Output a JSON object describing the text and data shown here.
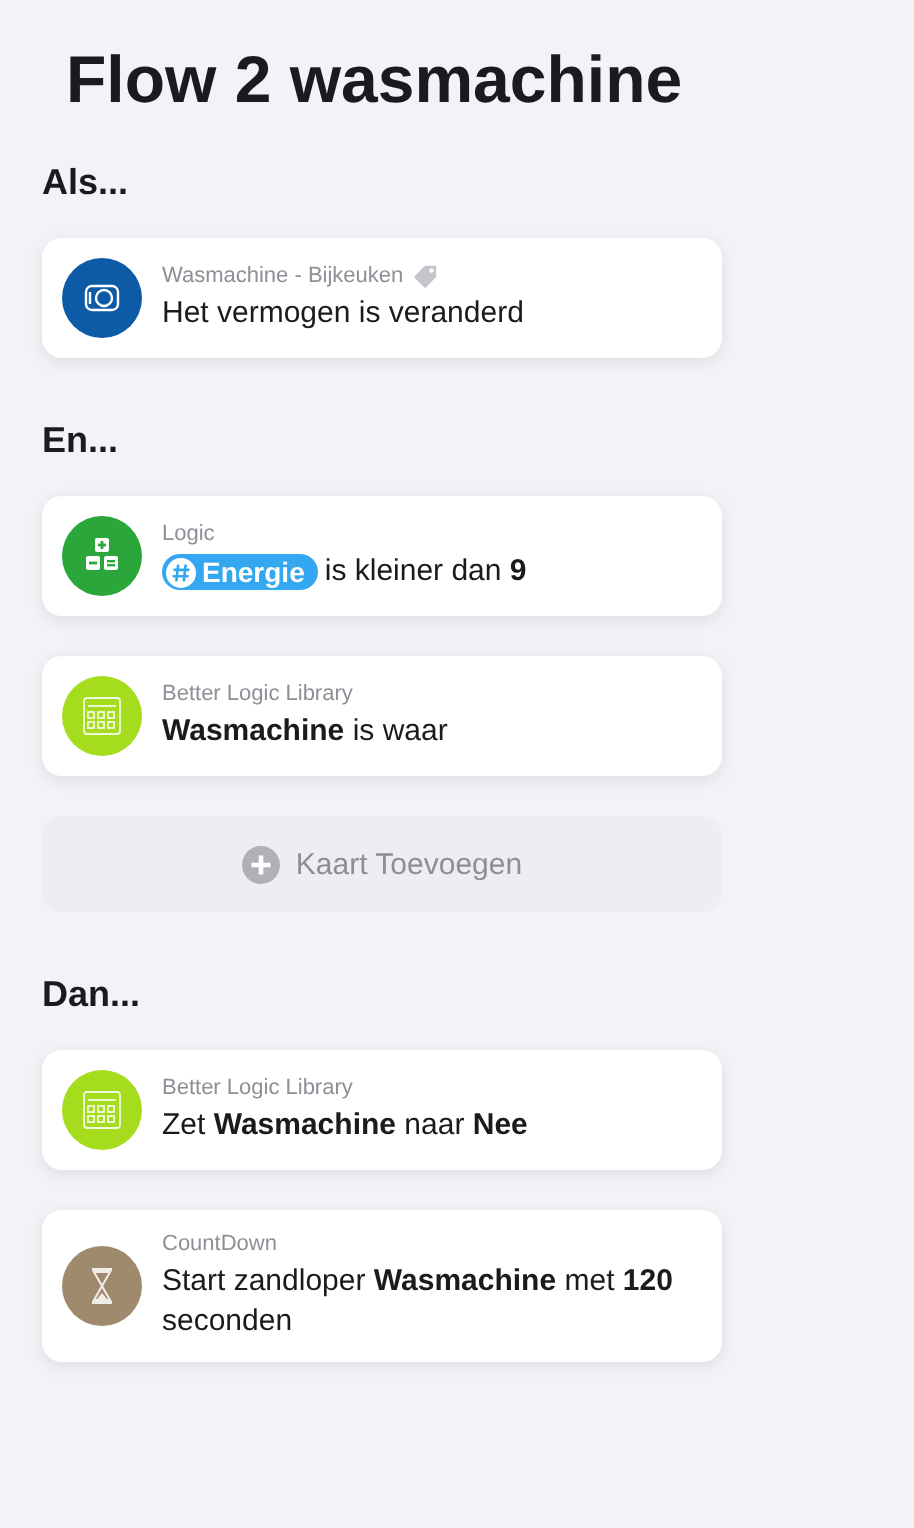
{
  "title": "Flow 2 wasmachine",
  "sections": [
    {
      "heading": "Als...",
      "cards": [
        {
          "kind": "device",
          "color": "#0d5aa7",
          "source": "Wasmachine - Bijkeuken",
          "tagged": true,
          "text": "Het vermogen is veranderd"
        }
      ]
    },
    {
      "heading": "En...",
      "cards": [
        {
          "kind": "logic",
          "color": "#2aa63a",
          "source": "Logic",
          "tagged": false,
          "token": "Energie",
          "text": "is kleiner dan **9**"
        },
        {
          "kind": "calculator",
          "color": "#a5dc1e",
          "source": "Better Logic Library",
          "tagged": false,
          "text": "**Wasmachine** is waar"
        }
      ],
      "add_button": "Kaart Toevoegen"
    },
    {
      "heading": "Dan...",
      "cards": [
        {
          "kind": "calculator",
          "color": "#a5dc1e",
          "source": "Better Logic Library",
          "tagged": false,
          "text": "Zet **Wasmachine** naar **Nee**"
        },
        {
          "kind": "hourglass",
          "color": "#a08a6e",
          "source": "CountDown",
          "tagged": false,
          "text": "Start zandloper **Wasmachine** met **120** seconden"
        }
      ]
    }
  ]
}
